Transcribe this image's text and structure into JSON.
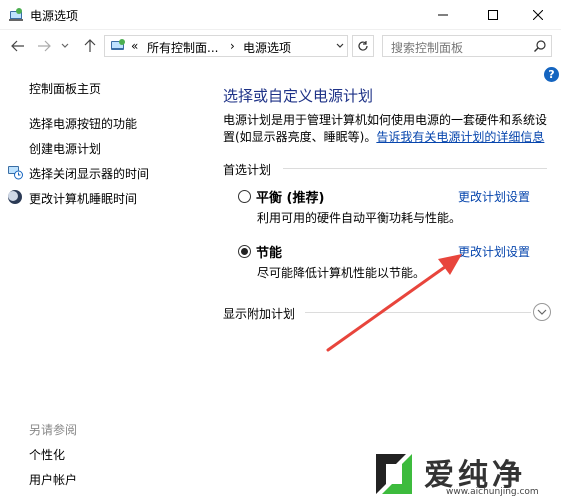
{
  "window": {
    "title": "电源选项",
    "icon": "power-options-icon",
    "controls": {
      "minimize": "minimize-icon",
      "maximize": "maximize-icon",
      "close": "close-icon"
    }
  },
  "address_bar": {
    "prefix": "«",
    "segments": [
      "所有控制面...",
      "电源选项"
    ],
    "separator": "›",
    "search_placeholder": "搜索控制面板"
  },
  "sidebar": {
    "home": "控制面板主页",
    "links": [
      {
        "label": "选择电源按钮的功能",
        "icon": ""
      },
      {
        "label": "创建电源计划",
        "icon": ""
      },
      {
        "label": "选择关闭显示器的时间",
        "icon": "monitor-clock-icon"
      },
      {
        "label": "更改计算机睡眠时间",
        "icon": "moon-icon"
      }
    ],
    "see_also_title": "另请参阅",
    "see_also": [
      "个性化",
      "用户帐户"
    ]
  },
  "main": {
    "heading": "选择或自定义电源计划",
    "desc_text": "电源计划是用于管理计算机如何使用电源的一套硬件和系统设置(如显示器亮度、睡眠等)。",
    "desc_link": "告诉我有关电源计划的详细信息",
    "preferred_label": "首选计划",
    "plans": [
      {
        "name": "平衡 (推荐)",
        "desc": "利用可用的硬件自动平衡功耗与性能。",
        "link": "更改计划设置",
        "selected": false
      },
      {
        "name": "节能",
        "desc": "尽可能降低计算机性能以节能。",
        "link": "更改计划设置",
        "selected": true
      }
    ],
    "extra_plans_label": "显示附加计划"
  },
  "watermark": {
    "title": "爱纯净",
    "url": "www.aichunjing.com"
  },
  "colors": {
    "heading": "#1e3287",
    "link": "#0645ad",
    "annotation_arrow": "#e8453c",
    "help": "#1565c0"
  }
}
